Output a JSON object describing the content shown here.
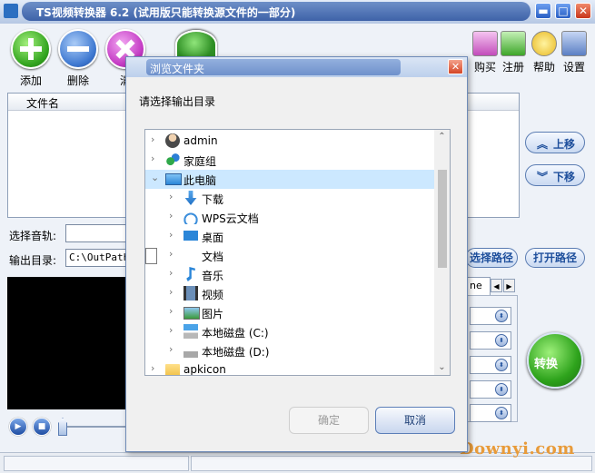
{
  "app": {
    "title": "TS视频转换器 6.2 (试用版只能转换源文件的一部分)",
    "window_controls": {
      "minimize": "▬",
      "maximize": "□",
      "close": "✕"
    }
  },
  "toolbar": {
    "add_label": "添加",
    "delete_label": "删除",
    "clear_label_partial": "清",
    "buy_label": "购买",
    "register_label": "注册",
    "help_label": "帮助",
    "settings_label": "设置"
  },
  "file_list": {
    "column_filename": "文件名"
  },
  "side_buttons": {
    "move_up": "上移",
    "move_down": "下移"
  },
  "audio": {
    "label": "选择音轨:"
  },
  "output": {
    "label": "输出目录:",
    "value": "C:\\OutPath",
    "choose_path": "选择路径",
    "open_path": "打开路径"
  },
  "tab_partial_text": "ne",
  "convert_label": "转换",
  "watermark": "Downyi.com",
  "dialog": {
    "title": "浏览文件夹",
    "instruction": "请选择输出目录",
    "ok": "确定",
    "cancel": "取消",
    "tree": [
      {
        "label": "admin",
        "level": 0,
        "icon": "user-icon",
        "expanded": false
      },
      {
        "label": "家庭组",
        "level": 0,
        "icon": "homegroup-icon",
        "expanded": false
      },
      {
        "label": "此电脑",
        "level": 0,
        "icon": "computer-icon",
        "expanded": true,
        "selected": true
      },
      {
        "label": "下载",
        "level": 1,
        "icon": "download-icon",
        "expanded": false
      },
      {
        "label": "WPS云文档",
        "level": 1,
        "icon": "cloud-icon",
        "expanded": false
      },
      {
        "label": "桌面",
        "level": 1,
        "icon": "desktop-icon",
        "expanded": false
      },
      {
        "label": "文档",
        "level": 1,
        "icon": "document-icon",
        "expanded": false
      },
      {
        "label": "音乐",
        "level": 1,
        "icon": "music-icon",
        "expanded": false
      },
      {
        "label": "视频",
        "level": 1,
        "icon": "video-icon",
        "expanded": false
      },
      {
        "label": "图片",
        "level": 1,
        "icon": "picture-icon",
        "expanded": false
      },
      {
        "label": "本地磁盘 (C:)",
        "level": 1,
        "icon": "windows-drive-icon",
        "expanded": false
      },
      {
        "label": "本地磁盘 (D:)",
        "level": 1,
        "icon": "drive-icon",
        "expanded": false
      },
      {
        "label": "apkicon",
        "level": 0,
        "icon": "folder-icon",
        "expanded": false
      }
    ]
  },
  "colors": {
    "accent": "#1e4f9c",
    "selection": "#cce8ff",
    "convert_green": "#2ea31c",
    "watermark": "#e89b3a"
  }
}
